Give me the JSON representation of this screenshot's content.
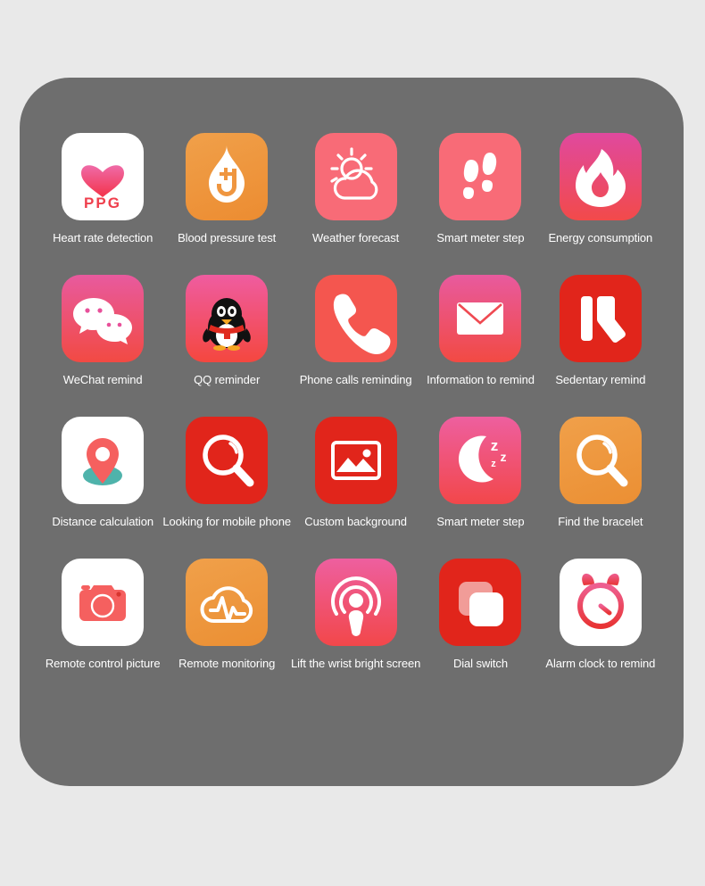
{
  "panel": {
    "background_color": "#6e6e6e",
    "page_background_color": "#e9e9e9"
  },
  "grid": {
    "columns": 5,
    "rows": 4,
    "items": [
      {
        "label": "Heart rate detection",
        "icon": "heart-ppg-icon",
        "tile_color": "#ffffff",
        "badge_text": "PPG"
      },
      {
        "label": "Blood pressure test",
        "icon": "blood-drop-icon",
        "tile_color": "#ef9640"
      },
      {
        "label": "Weather forecast",
        "icon": "sun-cloud-icon",
        "tile_color": "#f86b77"
      },
      {
        "label": "Smart meter step",
        "icon": "footsteps-icon",
        "tile_color": "#f86b77"
      },
      {
        "label": "Energy consumption",
        "icon": "flame-icon",
        "tile_color": "#e8509a"
      },
      {
        "label": "WeChat remind",
        "icon": "wechat-bubbles-icon",
        "tile_color": "#e8509a"
      },
      {
        "label": "QQ reminder",
        "icon": "qq-penguin-icon",
        "tile_color": "#e8509a"
      },
      {
        "label": "Phone calls reminding",
        "icon": "phone-handset-icon",
        "tile_color": "#f4564f"
      },
      {
        "label": "Information to remind",
        "icon": "envelope-icon",
        "tile_color": "#e8509a"
      },
      {
        "label": "Sedentary remind",
        "icon": "sedentary-icon",
        "tile_color": "#e1251b"
      },
      {
        "label": "Distance calculation",
        "icon": "map-pin-icon",
        "tile_color": "#ffffff"
      },
      {
        "label": "Looking for mobile phone",
        "icon": "magnifier-phone-icon",
        "tile_color": "#e1251b"
      },
      {
        "label": "Custom background",
        "icon": "picture-icon",
        "tile_color": "#e1251b"
      },
      {
        "label": "Smart meter step",
        "icon": "moon-sleep-icon",
        "tile_color": "#e8509a",
        "badge_text": "z z z"
      },
      {
        "label": "Find the bracelet",
        "icon": "magnifier-bracelet-icon",
        "tile_color": "#ef9640"
      },
      {
        "label": "Remote control picture",
        "icon": "camera-icon",
        "tile_color": "#ffffff"
      },
      {
        "label": "Remote monitoring",
        "icon": "cloud-pulse-icon",
        "tile_color": "#ef9640"
      },
      {
        "label": "Lift the wrist bright screen",
        "icon": "broadcast-person-icon",
        "tile_color": "#e8509a"
      },
      {
        "label": "Dial switch",
        "icon": "dial-switch-icon",
        "tile_color": "#e1251b"
      },
      {
        "label": "Alarm clock to remind",
        "icon": "alarm-clock-icon",
        "tile_color": "#ffffff"
      }
    ]
  },
  "colors": {
    "pink": "#e8509a",
    "coral": "#f86b77",
    "red": "#e1251b",
    "orange": "#ef9640",
    "white": "#ffffff",
    "teal": "#4fb3ab",
    "label_text": "#ffffff"
  }
}
